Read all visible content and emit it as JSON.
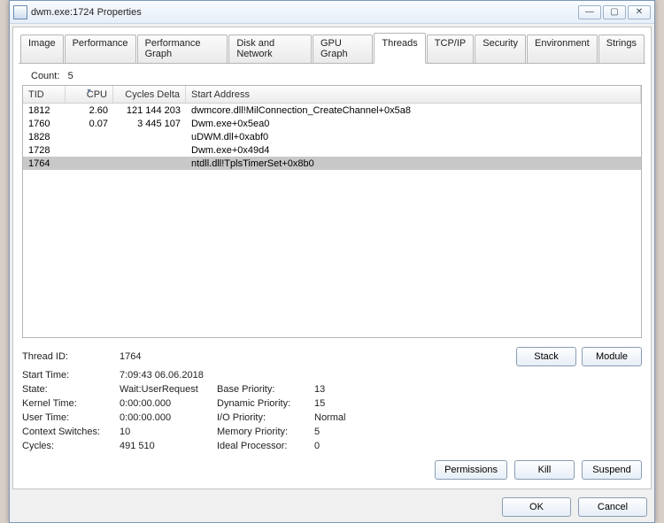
{
  "window": {
    "title": "dwm.exe:1724 Properties",
    "min_tooltip": "Minimize",
    "max_tooltip": "Maximize",
    "close_tooltip": "Close"
  },
  "tabs": {
    "items": [
      "Image",
      "Performance",
      "Performance Graph",
      "Disk and Network",
      "GPU Graph",
      "Threads",
      "TCP/IP",
      "Security",
      "Environment",
      "Strings"
    ],
    "active_index": 5
  },
  "threads": {
    "count_label": "Count:",
    "count_value": "5",
    "columns": {
      "tid": "TID",
      "cpu": "CPU",
      "cycles": "Cycles Delta",
      "start": "Start Address"
    },
    "sort_col": "cpu",
    "rows": [
      {
        "tid": "1812",
        "cpu": "2.60",
        "cycles": "121 144 203",
        "start": "dwmcore.dll!MilConnection_CreateChannel+0x5a8",
        "selected": false
      },
      {
        "tid": "1760",
        "cpu": "0.07",
        "cycles": "3 445 107",
        "start": "Dwm.exe+0x5ea0",
        "selected": false
      },
      {
        "tid": "1828",
        "cpu": "",
        "cycles": "",
        "start": "uDWM.dll+0xabf0",
        "selected": false
      },
      {
        "tid": "1728",
        "cpu": "",
        "cycles": "",
        "start": "Dwm.exe+0x49d4",
        "selected": false
      },
      {
        "tid": "1764",
        "cpu": "",
        "cycles": "",
        "start": "ntdll.dll!TplsTimerSet+0x8b0",
        "selected": true
      }
    ]
  },
  "detail_labels": {
    "thread_id": "Thread ID:",
    "start_time": "Start Time:",
    "state": "State:",
    "kernel_time": "Kernel Time:",
    "user_time": "User Time:",
    "context_switches": "Context Switches:",
    "cycles": "Cycles:",
    "base_priority": "Base Priority:",
    "dynamic_priority": "Dynamic Priority:",
    "io_priority": "I/O Priority:",
    "memory_priority": "Memory Priority:",
    "ideal_processor": "Ideal Processor:"
  },
  "detail_values": {
    "thread_id": "1764",
    "start_time": "7:09:43   06.06.2018",
    "state": "Wait:UserRequest",
    "kernel_time": "0:00:00.000",
    "user_time": "0:00:00.000",
    "context_switches": "10",
    "cycles": "491 510",
    "base_priority": "13",
    "dynamic_priority": "15",
    "io_priority": "Normal",
    "memory_priority": "5",
    "ideal_processor": "0"
  },
  "buttons": {
    "stack": "Stack",
    "module": "Module",
    "permissions": "Permissions",
    "kill": "Kill",
    "suspend": "Suspend",
    "ok": "OK",
    "cancel": "Cancel"
  }
}
